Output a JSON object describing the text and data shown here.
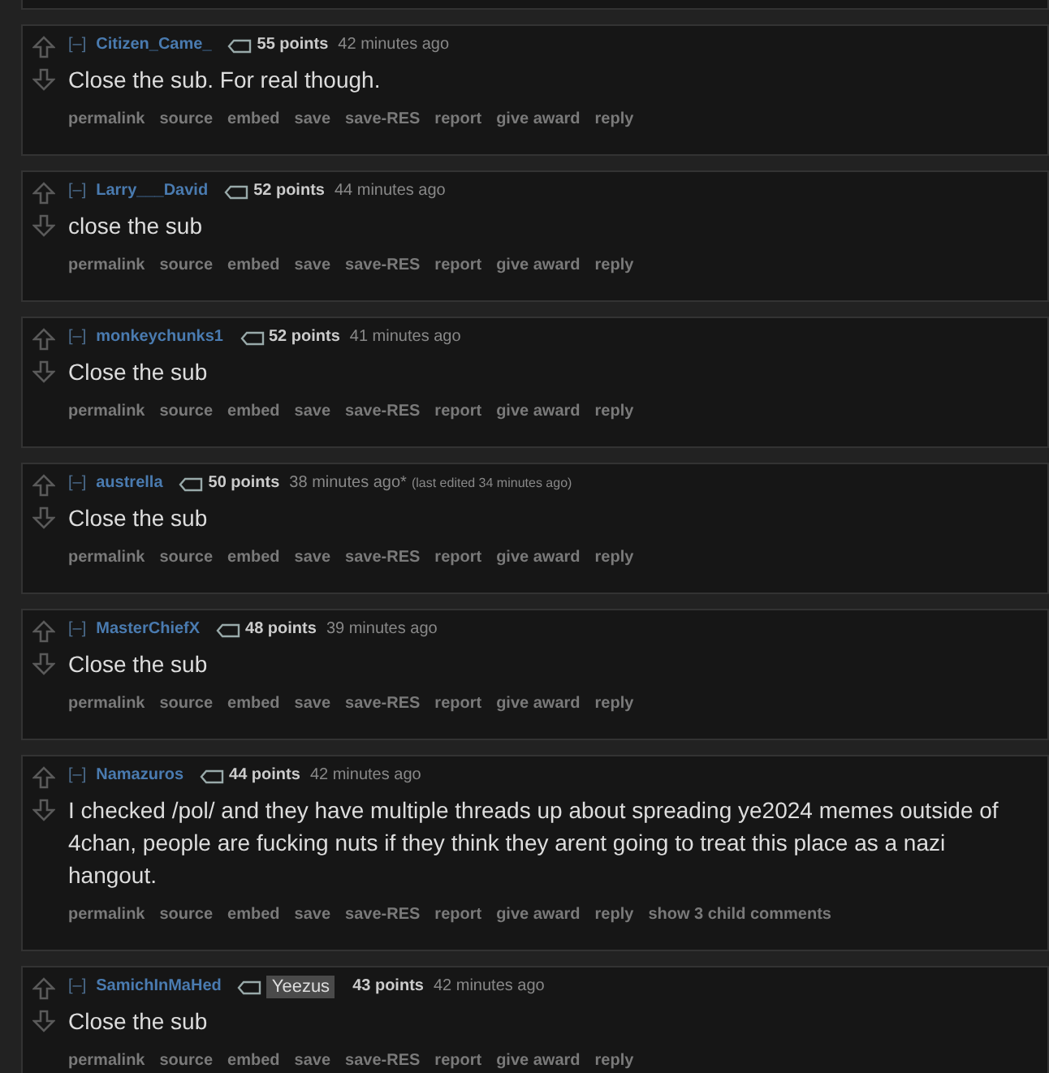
{
  "comments": [
    {
      "collapse": "[–]",
      "author": "Citizen_Came_",
      "points": "55 points",
      "time": "42 minutes ago",
      "body": "Close the sub. For real though.",
      "actions": [
        "permalink",
        "source",
        "embed",
        "save",
        "save-RES",
        "report",
        "give award",
        "reply"
      ]
    },
    {
      "collapse": "[–]",
      "author": "Larry___David",
      "points": "52 points",
      "time": "44 minutes ago",
      "body": "close the sub",
      "actions": [
        "permalink",
        "source",
        "embed",
        "save",
        "save-RES",
        "report",
        "give award",
        "reply"
      ]
    },
    {
      "collapse": "[–]",
      "author": "monkeychunks1",
      "points": "52 points",
      "time": "41 minutes ago",
      "body": "Close the sub",
      "actions": [
        "permalink",
        "source",
        "embed",
        "save",
        "save-RES",
        "report",
        "give award",
        "reply"
      ]
    },
    {
      "collapse": "[–]",
      "author": "austrella",
      "points": "50 points",
      "time": "38 minutes ago*",
      "edited": "(last edited 34 minutes ago)",
      "body": "Close the sub",
      "actions": [
        "permalink",
        "source",
        "embed",
        "save",
        "save-RES",
        "report",
        "give award",
        "reply"
      ]
    },
    {
      "collapse": "[–]",
      "author": "MasterChiefX",
      "points": "48 points",
      "time": "39 minutes ago",
      "body": "Close the sub",
      "actions": [
        "permalink",
        "source",
        "embed",
        "save",
        "save-RES",
        "report",
        "give award",
        "reply"
      ]
    },
    {
      "collapse": "[–]",
      "author": "Namazuros",
      "points": "44 points",
      "time": "42 minutes ago",
      "body": "I checked /pol/ and they have multiple threads up about spreading ye2024 memes outside of 4chan, people are fucking nuts if they think they arent going to treat this place as a nazi hangout.",
      "actions": [
        "permalink",
        "source",
        "embed",
        "save",
        "save-RES",
        "report",
        "give award",
        "reply",
        "show 3 child comments"
      ]
    },
    {
      "collapse": "[–]",
      "author": "SamichInMaHed",
      "flair": "Yeezus",
      "points": "43 points",
      "time": "42 minutes ago",
      "body": "Close the sub",
      "actions": [
        "permalink",
        "source",
        "embed",
        "save",
        "save-RES",
        "report",
        "give award",
        "reply"
      ]
    }
  ]
}
